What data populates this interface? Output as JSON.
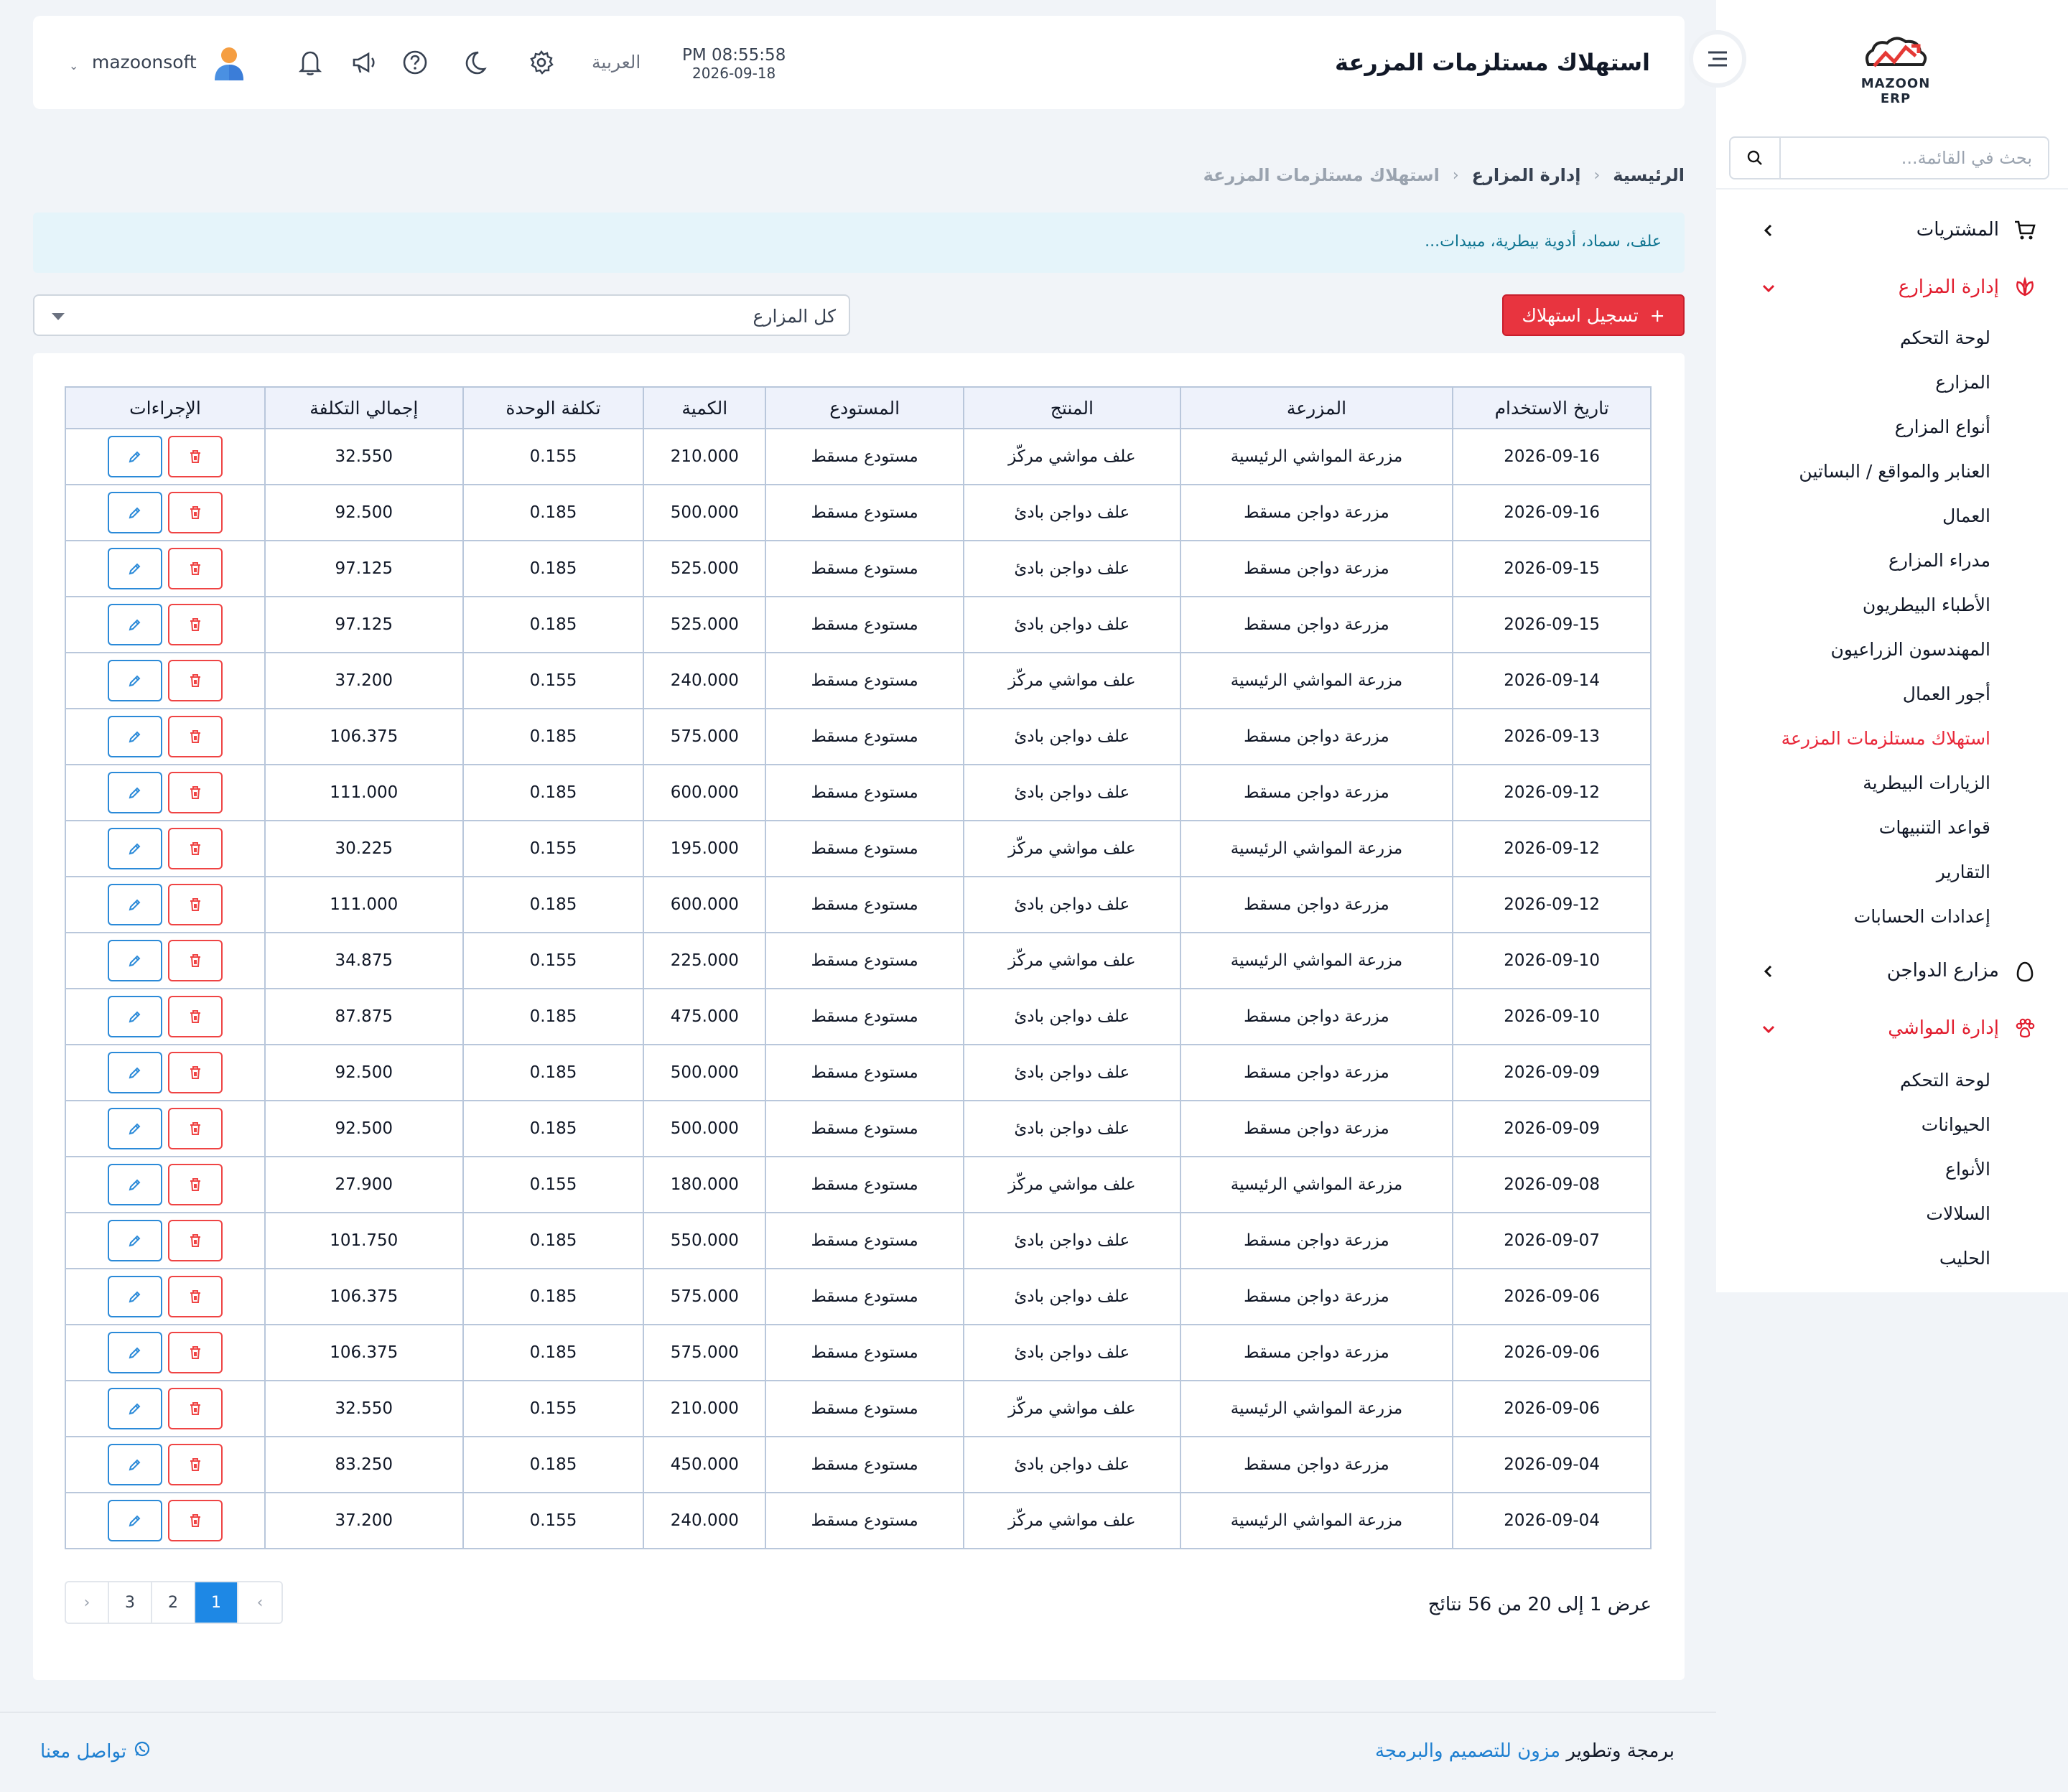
{
  "brand": {
    "logo_text": "MAZOON ERP",
    "logo_small": "ERP|ERP"
  },
  "sidebar": {
    "search_placeholder": "بحث في القائمة...",
    "groups": [
      {
        "label": "المشتريات",
        "icon": "cart-icon",
        "expanded": false
      },
      {
        "label": "إدارة المزارع",
        "icon": "leaf-icon",
        "expanded": true,
        "items": [
          "لوحة التحكم",
          "المزارع",
          "أنواع المزارع",
          "العنابر والمواقع / البساتين",
          "العمال",
          "مدراء المزارع",
          "الأطباء البيطريون",
          "المهندسون الزراعيون",
          "أجور العمال",
          "استهلاك مستلزمات المزرعة",
          "الزيارات البيطرية",
          "قواعد التنبيهات",
          "التقارير",
          "إعدادات الحسابات"
        ],
        "current_index": 9
      },
      {
        "label": "مزارع الدواجن",
        "icon": "egg-icon",
        "expanded": false
      },
      {
        "label": "إدارة المواشي",
        "icon": "paw-icon",
        "expanded": true,
        "items": [
          "لوحة التحكم",
          "الحيوانات",
          "الأنواع",
          "السلالات",
          "الحليب"
        ]
      }
    ]
  },
  "topbar": {
    "title": "استهلاك مستلزمات المزرعة",
    "time": "PM 08:55:58",
    "date": "2026-09-18",
    "language": "العربية",
    "username": "mazoonsoft"
  },
  "breadcrumb": [
    "الرئيسية",
    "إدارة المزارع",
    "استهلاك مستلزمات المزرعة"
  ],
  "info": "علف، سماد، أدوية بيطرية، مبيدات...",
  "toolbar": {
    "add_label": "تسجيل استهلاك",
    "add_plus": "+",
    "farm_filter": "كل المزارع"
  },
  "table": {
    "headers": [
      "تاريخ الاستخدام",
      "المزرعة",
      "المنتج",
      "المستودع",
      "الكمية",
      "تكلفة الوحدة",
      "إجمالي التكلفة",
      "الإجراءات"
    ],
    "rows": [
      [
        "2026-09-16",
        "مزرعة المواشي الرئيسية",
        "علف مواشي مركّز",
        "مستودع مسقط",
        "210.000",
        "0.155",
        "32.550"
      ],
      [
        "2026-09-16",
        "مزرعة دواجن مسقط",
        "علف دواجن بادئ",
        "مستودع مسقط",
        "500.000",
        "0.185",
        "92.500"
      ],
      [
        "2026-09-15",
        "مزرعة دواجن مسقط",
        "علف دواجن بادئ",
        "مستودع مسقط",
        "525.000",
        "0.185",
        "97.125"
      ],
      [
        "2026-09-15",
        "مزرعة دواجن مسقط",
        "علف دواجن بادئ",
        "مستودع مسقط",
        "525.000",
        "0.185",
        "97.125"
      ],
      [
        "2026-09-14",
        "مزرعة المواشي الرئيسية",
        "علف مواشي مركّز",
        "مستودع مسقط",
        "240.000",
        "0.155",
        "37.200"
      ],
      [
        "2026-09-13",
        "مزرعة دواجن مسقط",
        "علف دواجن بادئ",
        "مستودع مسقط",
        "575.000",
        "0.185",
        "106.375"
      ],
      [
        "2026-09-12",
        "مزرعة دواجن مسقط",
        "علف دواجن بادئ",
        "مستودع مسقط",
        "600.000",
        "0.185",
        "111.000"
      ],
      [
        "2026-09-12",
        "مزرعة المواشي الرئيسية",
        "علف مواشي مركّز",
        "مستودع مسقط",
        "195.000",
        "0.155",
        "30.225"
      ],
      [
        "2026-09-12",
        "مزرعة دواجن مسقط",
        "علف دواجن بادئ",
        "مستودع مسقط",
        "600.000",
        "0.185",
        "111.000"
      ],
      [
        "2026-09-10",
        "مزرعة المواشي الرئيسية",
        "علف مواشي مركّز",
        "مستودع مسقط",
        "225.000",
        "0.155",
        "34.875"
      ],
      [
        "2026-09-10",
        "مزرعة دواجن مسقط",
        "علف دواجن بادئ",
        "مستودع مسقط",
        "475.000",
        "0.185",
        "87.875"
      ],
      [
        "2026-09-09",
        "مزرعة دواجن مسقط",
        "علف دواجن بادئ",
        "مستودع مسقط",
        "500.000",
        "0.185",
        "92.500"
      ],
      [
        "2026-09-09",
        "مزرعة دواجن مسقط",
        "علف دواجن بادئ",
        "مستودع مسقط",
        "500.000",
        "0.185",
        "92.500"
      ],
      [
        "2026-09-08",
        "مزرعة المواشي الرئيسية",
        "علف مواشي مركّز",
        "مستودع مسقط",
        "180.000",
        "0.155",
        "27.900"
      ],
      [
        "2026-09-07",
        "مزرعة دواجن مسقط",
        "علف دواجن بادئ",
        "مستودع مسقط",
        "550.000",
        "0.185",
        "101.750"
      ],
      [
        "2026-09-06",
        "مزرعة دواجن مسقط",
        "علف دواجن بادئ",
        "مستودع مسقط",
        "575.000",
        "0.185",
        "106.375"
      ],
      [
        "2026-09-06",
        "مزرعة دواجن مسقط",
        "علف دواجن بادئ",
        "مستودع مسقط",
        "575.000",
        "0.185",
        "106.375"
      ],
      [
        "2026-09-06",
        "مزرعة المواشي الرئيسية",
        "علف مواشي مركّز",
        "مستودع مسقط",
        "210.000",
        "0.155",
        "32.550"
      ],
      [
        "2026-09-04",
        "مزرعة دواجن مسقط",
        "علف دواجن بادئ",
        "مستودع مسقط",
        "450.000",
        "0.185",
        "83.250"
      ],
      [
        "2026-09-04",
        "مزرعة المواشي الرئيسية",
        "علف مواشي مركّز",
        "مستودع مسقط",
        "240.000",
        "0.155",
        "37.200"
      ]
    ]
  },
  "pagination": {
    "summary": "عرض 1 إلى 20 من 56 نتائج",
    "pages": [
      "1",
      "2",
      "3"
    ],
    "current": "1",
    "prev": "‹",
    "next": "›"
  },
  "footer": {
    "prefix": "برمجة وتطوير",
    "company": "مزون للتصميم والبرمجة",
    "contact": "تواصل معنا"
  },
  "colors": {
    "accent_red": "#e8343f",
    "link_blue": "#1e7fd0",
    "active_menu": "#e8283a"
  }
}
